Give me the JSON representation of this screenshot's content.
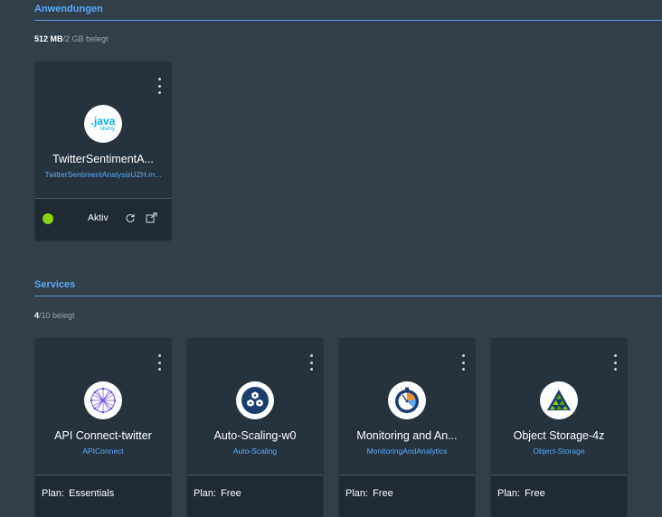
{
  "apps_section": {
    "title": "Anwendungen",
    "usage_used": "512 MB",
    "usage_rest": "2 GB belegt"
  },
  "apps": [
    {
      "logo_text_main": ".java",
      "logo_text_sub": "liberty",
      "name": "TwitterSentimentA...",
      "route": "TwitterSentimentAnalysisUZH.m...",
      "status": "Aktiv"
    }
  ],
  "services_section": {
    "title": "Services",
    "usage_used": "4",
    "usage_rest": "10 belegt"
  },
  "services": [
    {
      "name": "API Connect-twitter",
      "type": "APIConnect",
      "plan_label": "Plan:",
      "plan": "Essentials",
      "icon": "api-connect-icon"
    },
    {
      "name": "Auto-Scaling-w0",
      "type": "Auto-Scaling",
      "plan_label": "Plan:",
      "plan": "Free",
      "icon": "auto-scaling-icon"
    },
    {
      "name": "Monitoring and An...",
      "type": "MonitoringAndAnalytics",
      "plan_label": "Plan:",
      "plan": "Free",
      "icon": "monitoring-icon"
    },
    {
      "name": "Object Storage-4z",
      "type": "Object-Storage",
      "plan_label": "Plan:",
      "plan": "Free",
      "icon": "object-storage-icon"
    }
  ],
  "colors": {
    "background": "#323e48",
    "card": "#26323c",
    "accent": "#5aaafa",
    "status_ok": "#8cd211"
  }
}
